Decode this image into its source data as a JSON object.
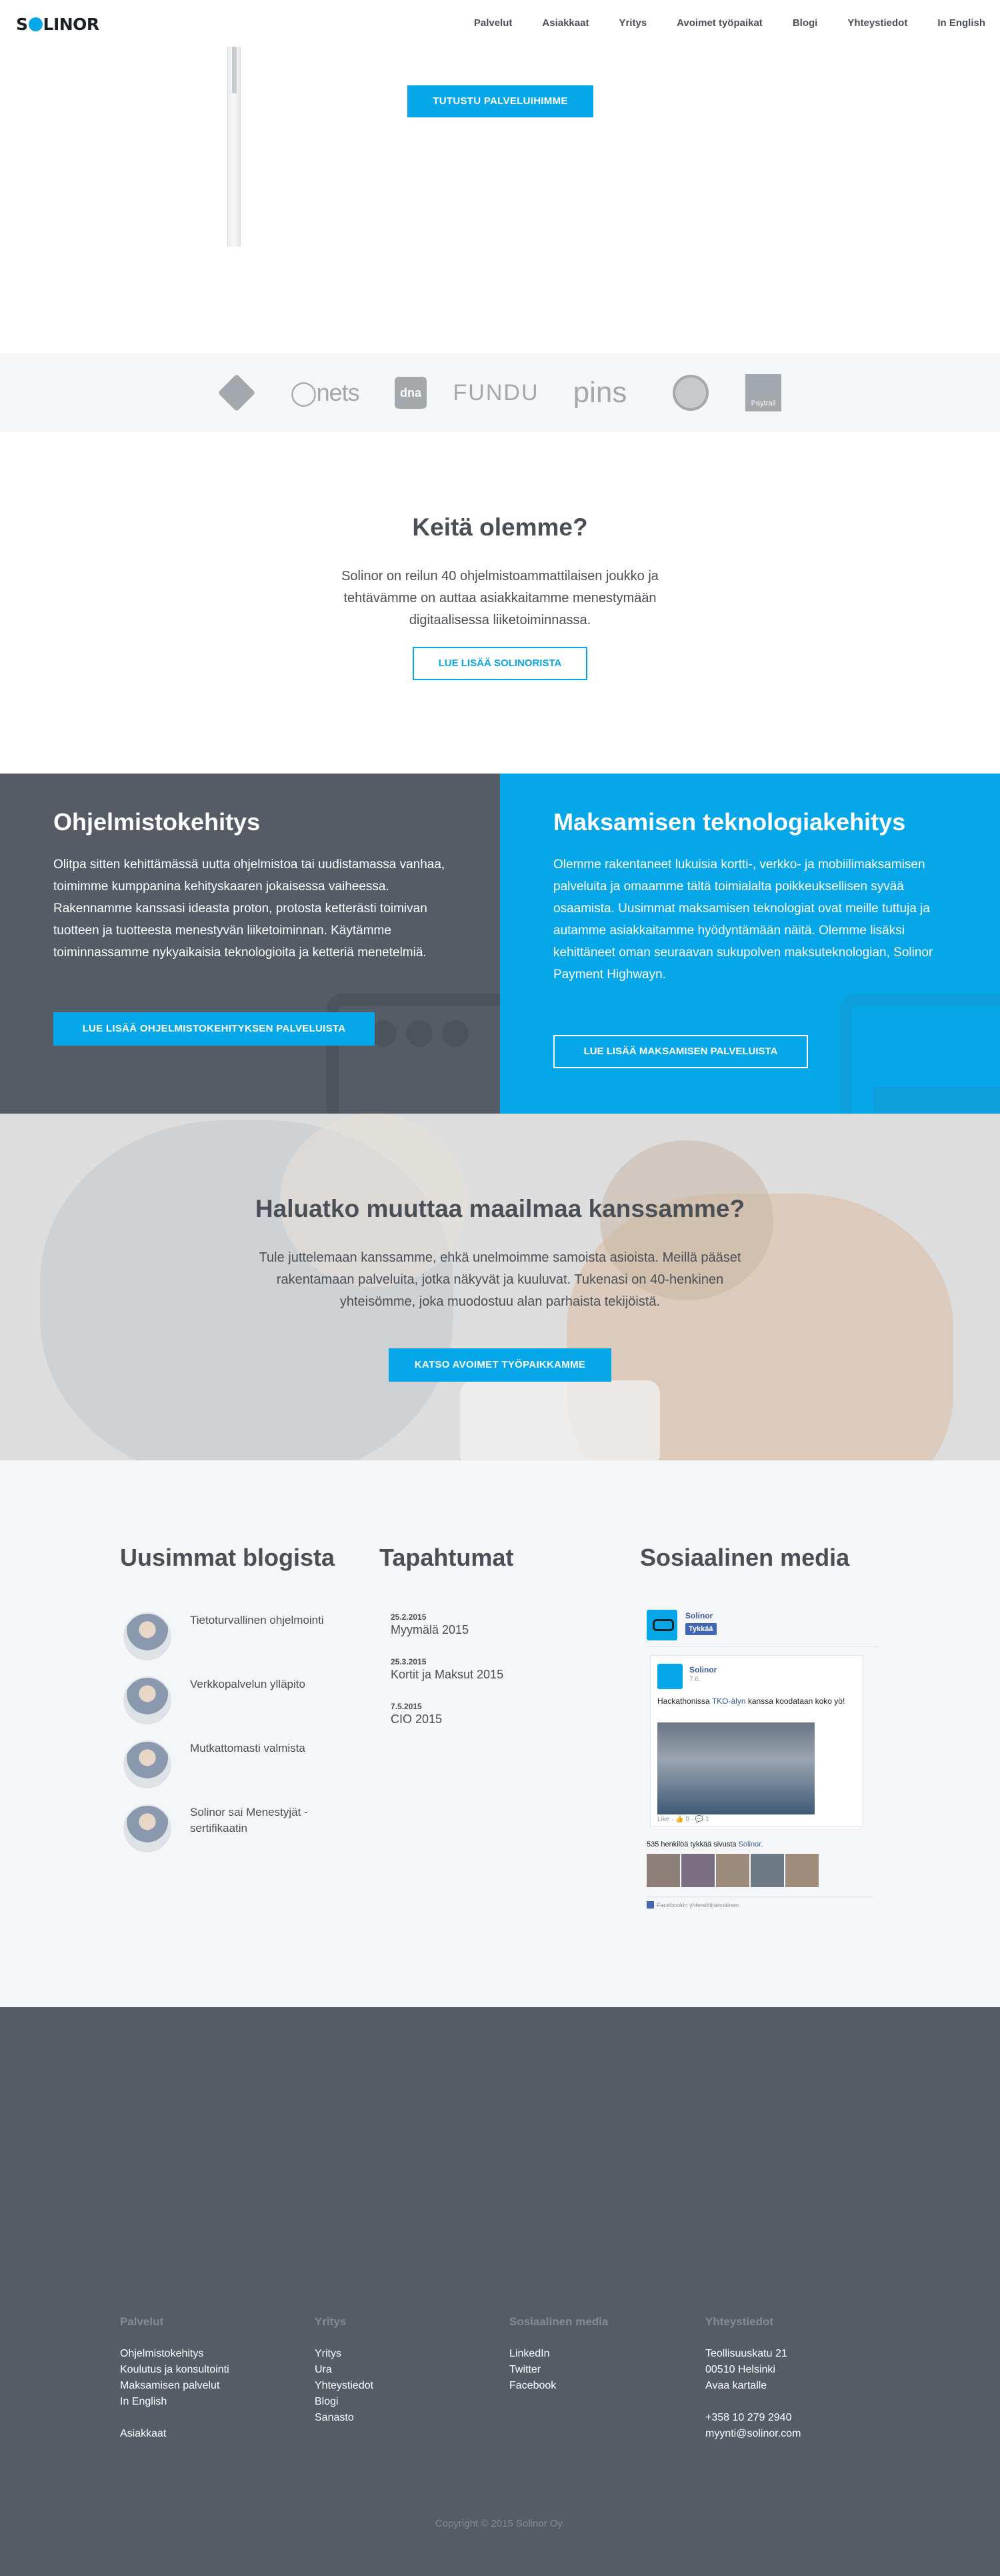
{
  "header": {
    "logo": "SOLINOR",
    "nav": [
      "Palvelut",
      "Asiakkaat",
      "Yritys",
      "Avoimet työpaikat",
      "Blogi",
      "Yhteystiedot",
      "In English"
    ]
  },
  "hero": {
    "button_label": "TUTUSTU PALVELUIHIMME"
  },
  "clients": {
    "logos": [
      "yle",
      "nets",
      "dna",
      "FUNDU",
      "pins",
      "seal",
      "Paytrail"
    ]
  },
  "who": {
    "title": "Keitä olemme?",
    "text": "Solinor on reilun 40 ohjelmistoammattilaisen joukko ja tehtävämme on auttaa asiakkaitamme menestymään digitaalisessa liiketoiminnassa.",
    "button_label": "LUE LISÄÄ SOLINORISTA"
  },
  "software": {
    "title": "Ohjelmistokehitys",
    "text": "Olitpa sitten kehittämässä uutta ohjelmistoa tai uudistamassa vanhaa, toimimme kumppanina kehityskaaren jokaisessa vaiheessa. Rakennamme kanssasi ideasta proton, protosta ketterästi toimivan tuotteen ja tuotteesta menestyvän liiketoiminnan. Käytämme toiminnassamme nykyaikaisia teknologioita ja ketteriä menetelmiä.",
    "button_label": "LUE LISÄÄ OHJELMISTOKEHITYKSEN PALVELUISTA"
  },
  "payments": {
    "title": "Maksamisen teknologiakehitys",
    "text": "Olemme rakentaneet lukuisia kortti-, verkko- ja mobiilimaksamisen palveluita ja omaamme tältä toimialalta poikkeuksellisen syvää osaamista. Uusimmat maksamisen teknologiat ovat meille tuttuja ja autamme asiakkaitamme hyödyntämään näitä. Olemme lisäksi kehittäneet oman seuraavan sukupolven maksuteknologian, Solinor Payment Highwayn.",
    "button_label": "LUE LISÄÄ MAKSAMISEN PALVELUISTA"
  },
  "careers": {
    "title": "Haluatko muuttaa maailmaa kanssamme?",
    "text": "Tule juttelemaan kanssamme, ehkä unelmoimme samoista asioista. Meillä pääset rakentamaan palveluita, jotka näkyvät ja kuuluvat. Tukenasi on 40-henkinen yhteisömme, joka muodostuu alan parhaista tekijöistä.",
    "button_label": "KATSO AVOIMET TYÖPAIKKAMME"
  },
  "blog": {
    "title": "Uusimmat blogista",
    "posts": [
      "Tietoturvallinen ohjelmointi",
      "Verkkopalvelun ylläpito",
      "Mutkattomasti valmista",
      "Solinor sai Menestyjät -sertifikaatin"
    ]
  },
  "events": {
    "title": "Tapahtumat",
    "items": [
      {
        "date": "25.2.2015",
        "name": "Myymälä 2015"
      },
      {
        "date": "25.3.2015",
        "name": "Kortit ja Maksut 2015"
      },
      {
        "date": "7.5.2015",
        "name": "CIO 2015"
      }
    ]
  },
  "social": {
    "title": "Sosiaalinen media",
    "page_name": "Solinor",
    "like_label": "Tykkää",
    "post_author": "Solinor",
    "post_date": "7.6.",
    "post_text_before": "Hackathonissa ",
    "post_link": "TKO-älyn",
    "post_text_after": " kanssa koodataan koko yö!",
    "post_actions": "Like · 👍 0 · 💬 1",
    "fans_text": "535 henkilöä tykkää sivusta ",
    "fans_link": "Solinor.",
    "plugin_text": "Facebookin yhteisöliitännäinen"
  },
  "footer": {
    "services_title": "Palvelut",
    "services": [
      "Ohjelmistokehitys",
      "Koulutus ja konsultointi",
      "Maksamisen palvelut",
      "In English"
    ],
    "clients_link": "Asiakkaat",
    "company_title": "Yritys",
    "company": [
      "Yritys",
      "Ura",
      "Yhteystiedot",
      "Blogi",
      "Sanasto"
    ],
    "social_title": "Sosiaalinen media",
    "social": [
      "LinkedIn",
      "Twitter",
      "Facebook"
    ],
    "contact_title": "Yhteystiedot",
    "address": [
      "Teollisuuskatu 21",
      "00510 Helsinki",
      "Avaa kartalle"
    ],
    "phone": "+358 10 279 2940",
    "email": "myynti@solinor.com",
    "copyright": "Copyright © 2015 Solinor Oy."
  }
}
